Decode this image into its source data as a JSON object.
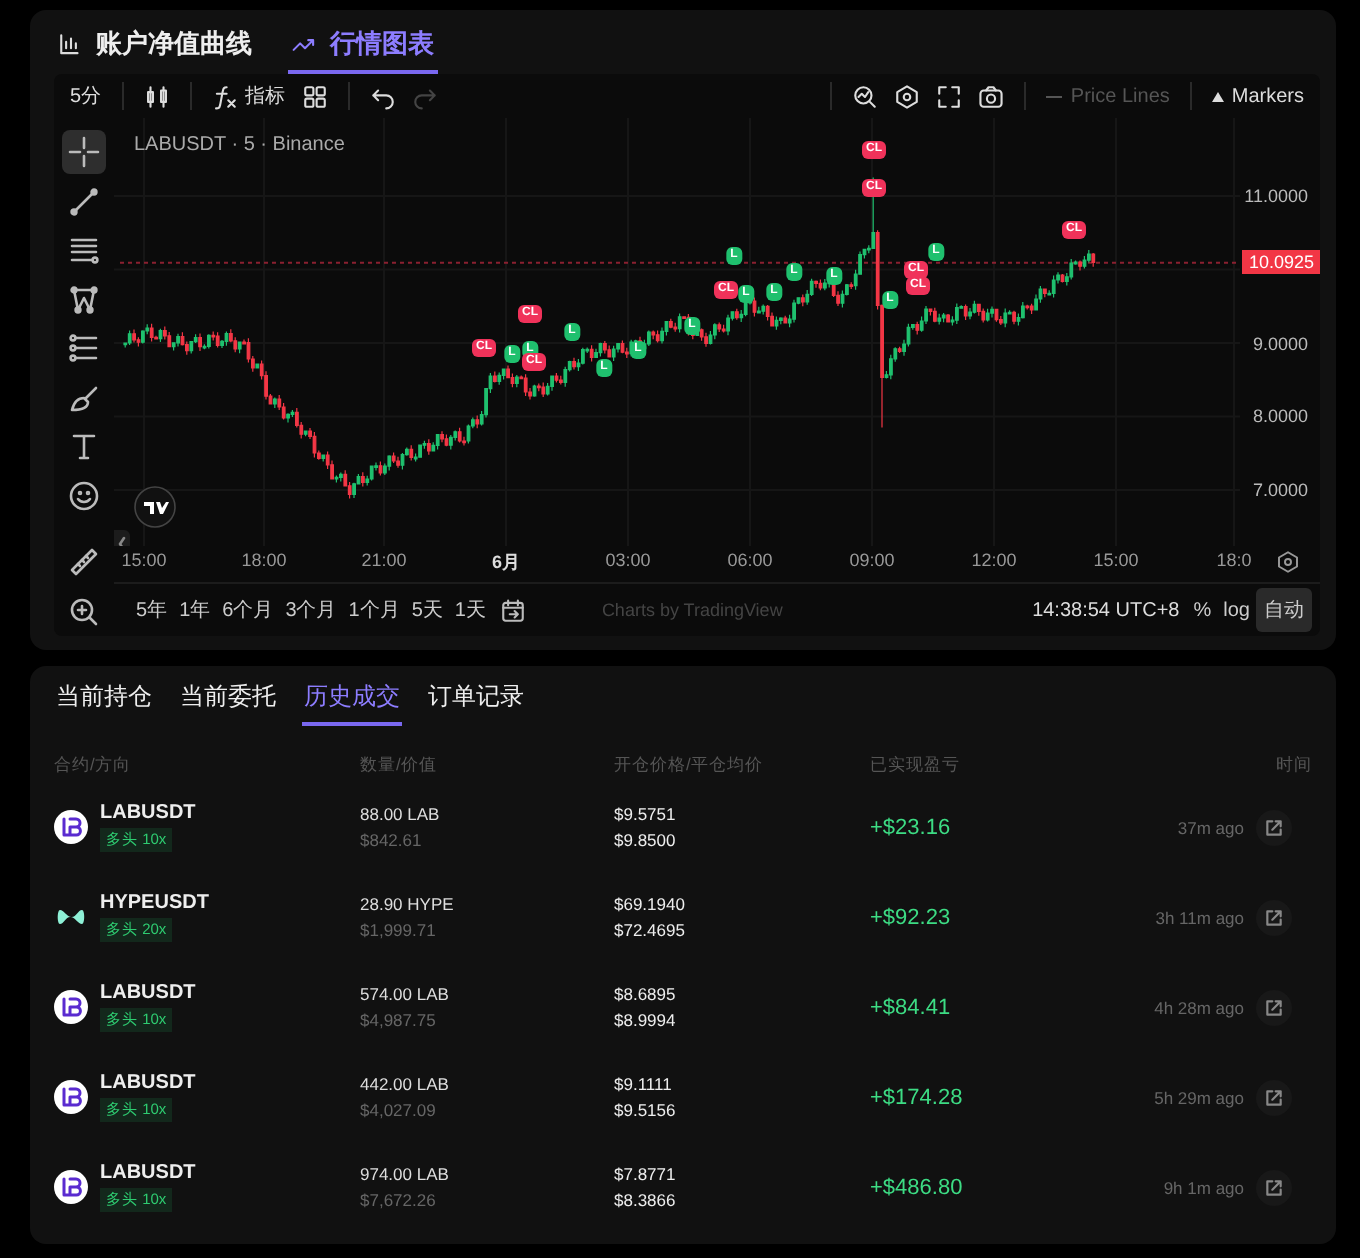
{
  "view_tabs": [
    {
      "label": "账户净值曲线",
      "selected": false
    },
    {
      "label": "行情图表",
      "selected": true
    }
  ],
  "toolbar": {
    "interval": "5分",
    "indicators": "指标",
    "redo_disabled": true,
    "price_lines": {
      "label": "Price Lines",
      "on": false
    },
    "markers": {
      "label": "Markers",
      "on": true
    }
  },
  "tools": [
    {
      "kind": "crosshair",
      "selected": true
    },
    {
      "kind": "trendline",
      "selected": false
    },
    {
      "kind": "hlines",
      "selected": false
    },
    {
      "kind": "pattern",
      "selected": false
    },
    {
      "kind": "fib",
      "selected": false
    },
    {
      "kind": "brush",
      "selected": false
    },
    {
      "kind": "text",
      "selected": false
    },
    {
      "kind": "emoji",
      "selected": false
    },
    {
      "kind": "ruler",
      "selected": false
    },
    {
      "kind": "zoom",
      "selected": false
    }
  ],
  "chart": {
    "title": "LABUSDT · 5 · Binance",
    "price_ticks": [
      "11.0000",
      "9.0000",
      "8.0000",
      "7.0000"
    ],
    "last_price": "10.0925",
    "time_ticks": [
      {
        "label": "15:00",
        "bold": false
      },
      {
        "label": "18:00",
        "bold": false
      },
      {
        "label": "21:00",
        "bold": false
      },
      {
        "label": "6月",
        "bold": true
      },
      {
        "label": "03:00",
        "bold": false
      },
      {
        "label": "06:00",
        "bold": false
      },
      {
        "label": "09:00",
        "bold": false
      },
      {
        "label": "12:00",
        "bold": false
      },
      {
        "label": "15:00",
        "bold": false
      },
      {
        "label": "18:0",
        "bold": false
      }
    ],
    "markers": [
      {
        "label": "CL",
        "kind": "close"
      },
      {
        "label": "CL",
        "kind": "close"
      },
      {
        "label": "CL",
        "kind": "close"
      },
      {
        "label": "L",
        "kind": "long"
      },
      {
        "label": "L",
        "kind": "long"
      },
      {
        "label": "L",
        "kind": "long"
      },
      {
        "label": "L",
        "kind": "long"
      },
      {
        "label": "CL",
        "kind": "close"
      },
      {
        "label": "CL",
        "kind": "close"
      },
      {
        "label": "L",
        "kind": "long"
      },
      {
        "label": "L",
        "kind": "long"
      },
      {
        "label": "L",
        "kind": "long"
      },
      {
        "label": "CL",
        "kind": "close"
      },
      {
        "label": "CL",
        "kind": "close"
      },
      {
        "label": "L",
        "kind": "long"
      },
      {
        "label": "L",
        "kind": "long"
      },
      {
        "label": "CL",
        "kind": "close"
      },
      {
        "label": "L",
        "kind": "long"
      },
      {
        "label": "L",
        "kind": "long"
      },
      {
        "label": "L",
        "kind": "long"
      },
      {
        "label": "CL",
        "kind": "close"
      },
      {
        "label": "L",
        "kind": "long"
      }
    ]
  },
  "ranges": [
    {
      "label": "5年"
    },
    {
      "label": "1年"
    },
    {
      "label": "6个月"
    },
    {
      "label": "3个月"
    },
    {
      "label": "1个月"
    },
    {
      "label": "5天"
    },
    {
      "label": "1天"
    }
  ],
  "credit": "Charts by TradingView",
  "clock": "14:38:54 UTC+8",
  "scale_buttons": [
    {
      "label": "%",
      "selected": false
    },
    {
      "label": "log",
      "selected": false
    },
    {
      "label": "自动",
      "selected": true
    }
  ],
  "order_tabs": [
    {
      "label": "当前持仓",
      "selected": false
    },
    {
      "label": "当前委托",
      "selected": false
    },
    {
      "label": "历史成交",
      "selected": true
    },
    {
      "label": "订单记录",
      "selected": false
    }
  ],
  "columns": [
    "合约/方向",
    "数量/价值",
    "开仓价格/平仓均价",
    "已实现盈亏",
    "时间"
  ],
  "rows": [
    {
      "kind": "lab",
      "symbol": "LABUSDT",
      "side": "多头 10x",
      "quantity": "88.00 LAB",
      "value": "$842.61",
      "open_price": "$9.5751",
      "close_price": "$9.8500",
      "pnl": "+$23.16",
      "time": "37m ago"
    },
    {
      "kind": "hype",
      "symbol": "HYPEUSDT",
      "side": "多头 20x",
      "quantity": "28.90 HYPE",
      "value": "$1,999.71",
      "open_price": "$69.1940",
      "close_price": "$72.4695",
      "pnl": "+$92.23",
      "time": "3h 11m ago"
    },
    {
      "kind": "lab",
      "symbol": "LABUSDT",
      "side": "多头 10x",
      "quantity": "574.00 LAB",
      "value": "$4,987.75",
      "open_price": "$8.6895",
      "close_price": "$8.9994",
      "pnl": "+$84.41",
      "time": "4h 28m ago"
    },
    {
      "kind": "lab",
      "symbol": "LABUSDT",
      "side": "多头 10x",
      "quantity": "442.00 LAB",
      "value": "$4,027.09",
      "open_price": "$9.1111",
      "close_price": "$9.5156",
      "pnl": "+$174.28",
      "time": "5h 29m ago"
    },
    {
      "kind": "lab",
      "symbol": "LABUSDT",
      "side": "多头 10x",
      "quantity": "974.00 LAB",
      "value": "$7,672.26",
      "open_price": "$7.8771",
      "close_price": "$8.3866",
      "pnl": "+$486.80",
      "time": "9h 1m ago"
    }
  ]
}
